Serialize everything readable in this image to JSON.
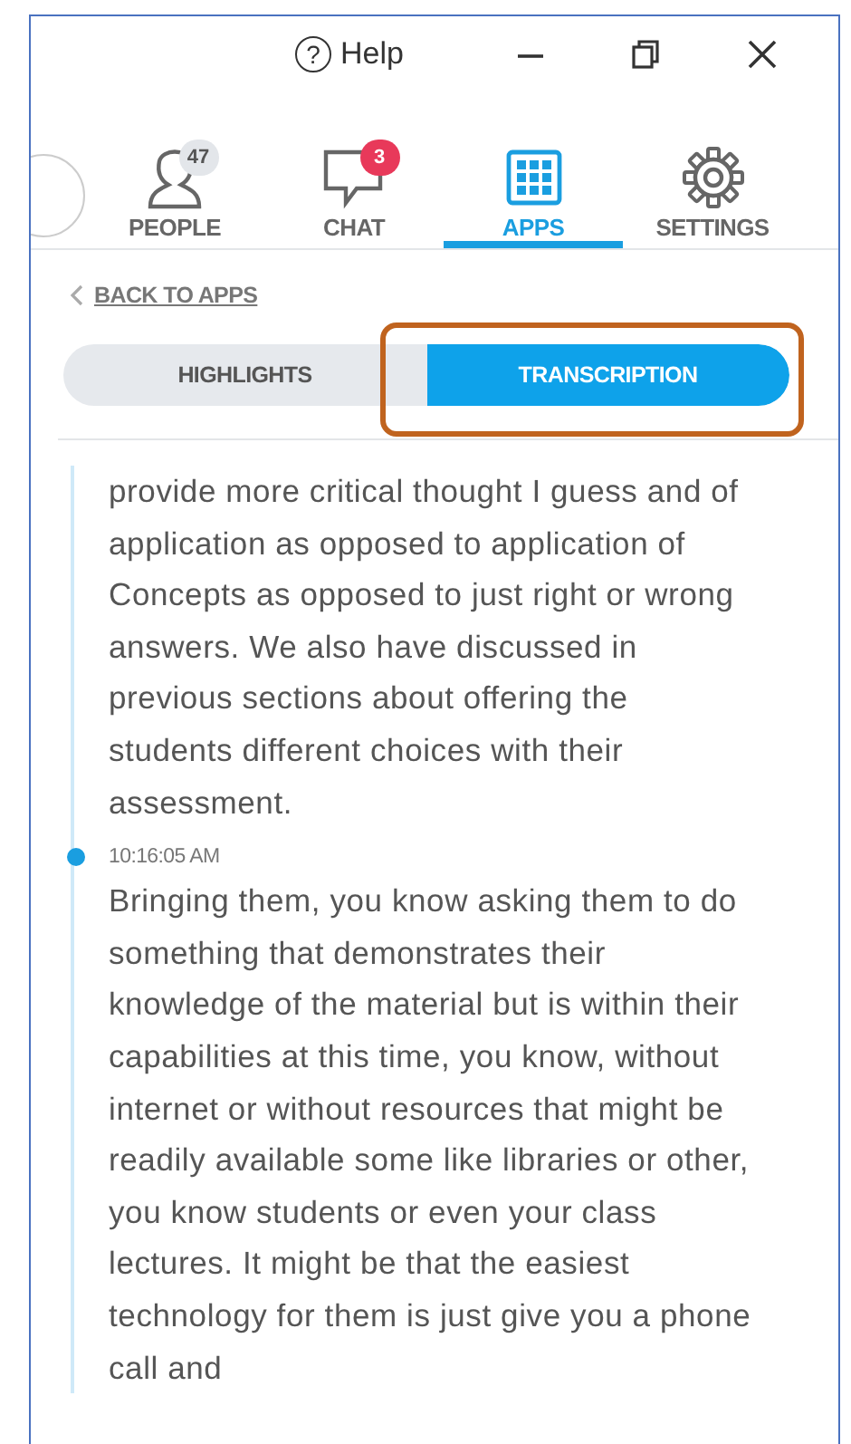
{
  "title_bar": {
    "help": {
      "icon": "?",
      "label": "Help"
    }
  },
  "nav_tabs": [
    {
      "kind": "people",
      "label": "PEOPLE",
      "badge": "47",
      "selected": false
    },
    {
      "kind": "chat",
      "label": "CHAT",
      "badge": "3",
      "selected": false
    },
    {
      "kind": "apps",
      "label": "APPS",
      "selected": true
    },
    {
      "kind": "settings",
      "label": "SETTINGS",
      "selected": false
    }
  ],
  "back_link": "BACK TO APPS",
  "segments": [
    {
      "label": "HIGHLIGHTS",
      "selected": false
    },
    {
      "label": "TRANSCRIPTION",
      "selected": true
    }
  ],
  "transcript": [
    {
      "lines": [
        "provide more critical thought I guess and of",
        "application as opposed to application of",
        "Concepts as opposed to just right or wrong",
        "answers. We also have discussed in",
        "previous sections about offering the",
        "students different choices with their",
        "assessment."
      ]
    },
    {
      "time": "10:16:05 AM",
      "lines": [
        "Bringing them, you know asking them to do",
        "something that demonstrates their",
        "knowledge of the material but is within their",
        "capabilities at this time, you know, without",
        "internet or without resources that might be",
        "readily available some like libraries or other,",
        "you know students or even your class",
        "lectures. It might be that the easiest",
        "technology for them is just give you a phone",
        "call and"
      ]
    }
  ]
}
